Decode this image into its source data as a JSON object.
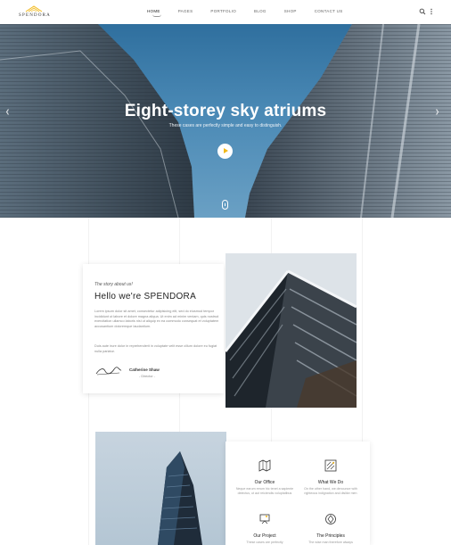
{
  "header": {
    "logo_text": "SPENDORA",
    "nav": [
      "HOME",
      "PAGES",
      "PORTFOLIO",
      "BLOG",
      "SHOP",
      "CONTACT US"
    ],
    "icons": [
      "search-icon",
      "more-vertical-icon"
    ]
  },
  "hero": {
    "title": "Eight-storey sky atriums",
    "subtitle": "These cases are perfectly simple and easy to distinguish."
  },
  "story": {
    "kicker": "The story about us!",
    "title": "Hello we're SPENDORA",
    "paragraph1": "Lorem ipsum dolor sit amet, consectetur adipisicing elit, sed do eiusmod tempor incididunt ut labore et dolore magna aliqua. Ut enim ad minim veniam, quis nostrud exercitation ullamco laboris nisi ut aliquip ex ea commodo consequat et voluptatem accusantium doloremque laudantium.",
    "paragraph2": "Duis aute irure dolor in reprehenderit in voluptate velit esse cillum dolore eu fugiat nulla pariatur.",
    "signer_name": "Catherine Shaw",
    "signer_role": "- Director -"
  },
  "services": [
    {
      "title": "Our Office",
      "text": "Neque earum rerum hic tenet a sapiente delectus, ut aut reiciendis voluptatibus",
      "icon": "map-icon"
    },
    {
      "title": "What We Do",
      "text": "On the other hand, we denounce with righteous indignation and dislike men",
      "icon": "drafting-icon"
    },
    {
      "title": "Our Project",
      "text": "These cases are perfectly",
      "icon": "project-icon"
    },
    {
      "title": "The Principles",
      "text": "The wise man therefore always",
      "icon": "principles-icon"
    }
  ],
  "colors": {
    "accent": "#f2b91a",
    "sky": "#3f7eaa"
  }
}
